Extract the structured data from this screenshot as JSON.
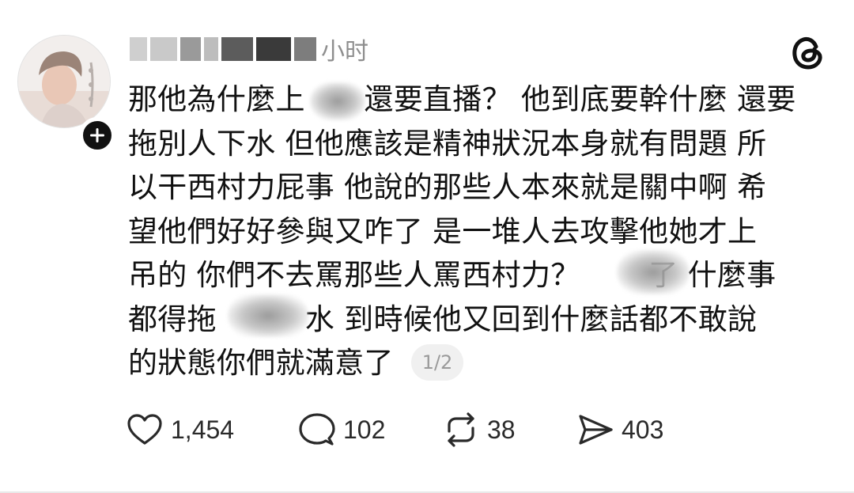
{
  "post": {
    "username_suffix": "小时",
    "pagination": "1/2",
    "lines": [
      "那他為什麼上　　還要直播？ 他到底要幹什麼 還要",
      "拖別人下水 但他應該是精神狀況本身就有問題 所",
      "以干西村力屁事 他說的那些人本來就是關中啊 希",
      "望他們好好參與又咋了 是一堆人去攻擊他她才上",
      "吊的 你們不去罵那些人罵西村力？ 　　了 什麼事",
      "都得拖　　　水 到時候他又回到什麼話都不敢說",
      "的狀態你們就滿意了"
    ],
    "actions": {
      "likes": "1,454",
      "replies": "102",
      "reposts": "38",
      "shares": "403"
    }
  },
  "icons": {
    "avatar": "profile-photo",
    "follow": "plus-icon",
    "brand": "threads-logo-icon",
    "like": "heart-icon",
    "reply": "speech-bubble-icon",
    "repost": "repost-arrows-icon",
    "share": "paper-plane-icon"
  },
  "colors": {
    "text": "#111111",
    "muted": "#8e8e8e",
    "pill_bg": "#f0f0f0",
    "badge": "#111111"
  }
}
